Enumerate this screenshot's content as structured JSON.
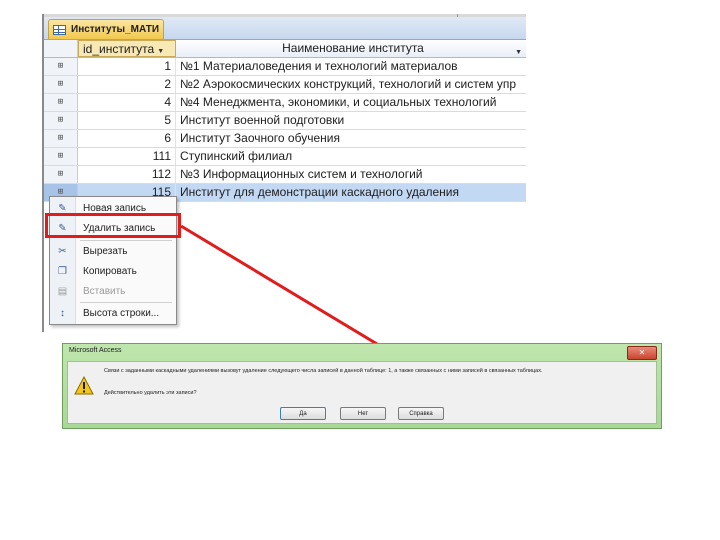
{
  "table": {
    "tab_label": "Институты_МАТИ",
    "columns": [
      "id_института",
      "Наименование института"
    ],
    "rows": [
      {
        "id": "1",
        "name": "№1 Материаловедения и технологий материалов"
      },
      {
        "id": "2",
        "name": "№2 Аэрокосмических конструкций, технологий и систем упр"
      },
      {
        "id": "4",
        "name": "№4 Менеджмента, экономики, и социальных технологий"
      },
      {
        "id": "5",
        "name": "Институт военной подготовки"
      },
      {
        "id": "6",
        "name": "Институт Заочного обучения"
      },
      {
        "id": "111",
        "name": "Ступинский филиал"
      },
      {
        "id": "112",
        "name": "№3 Информационных систем и технологий"
      },
      {
        "id": "115",
        "name": "Институт для демонстрации каскадного удаления"
      }
    ],
    "selected_row": 7
  },
  "context_menu": {
    "items": [
      {
        "label": "Новая запись",
        "icon": "new-record-icon"
      },
      {
        "label": "Удалить запись",
        "icon": "delete-record-icon"
      },
      {
        "label": "Вырезать",
        "icon": "scissors-icon"
      },
      {
        "label": "Копировать",
        "icon": "copy-icon"
      },
      {
        "label": "Вставить",
        "icon": "paste-icon"
      },
      {
        "label": "Высота строки...",
        "icon": "row-height-icon"
      }
    ]
  },
  "dialog": {
    "title": "Microsoft Access",
    "message": "Связи с заданными каскадными удалениями вызовут удаление следующего числа записей в данной таблице: 1, а также связанных с ними записей в связанных таблицах.",
    "question": "Действительно удалить эти записи?",
    "buttons": {
      "yes": "Да",
      "no": "Нет",
      "help": "Справка"
    },
    "close_label": "✕"
  },
  "colors": {
    "highlight": "#e01c1c",
    "selected_row": "#c3d9f3",
    "dialog_frame": "#a8d896"
  }
}
